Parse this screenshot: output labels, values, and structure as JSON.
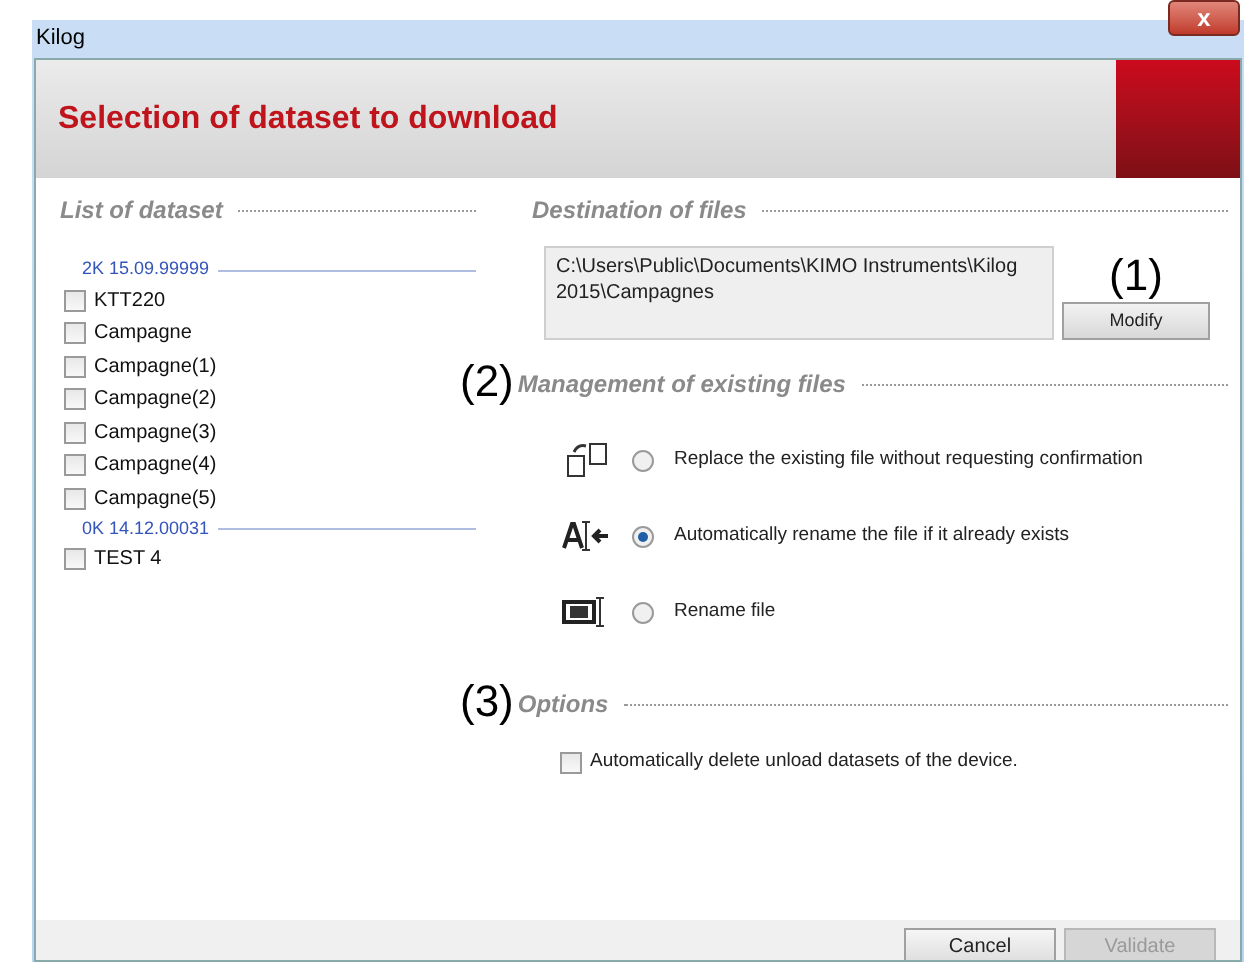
{
  "window": {
    "title": "Kilog",
    "close": "x"
  },
  "header": {
    "title": "Selection of dataset to download"
  },
  "datasets": {
    "title": "List of dataset",
    "groups": [
      {
        "name": "2K 15.09.99999",
        "items": [
          {
            "label": "KTT220",
            "checked": false
          },
          {
            "label": "Campagne",
            "checked": false
          },
          {
            "label": "Campagne(1)",
            "checked": false
          },
          {
            "label": "Campagne(2)",
            "checked": false
          },
          {
            "label": "Campagne(3)",
            "checked": false
          },
          {
            "label": "Campagne(4)",
            "checked": false
          },
          {
            "label": "Campagne(5)",
            "checked": false
          }
        ]
      },
      {
        "name": "0K 14.12.00031",
        "items": [
          {
            "label": "TEST 4",
            "checked": false
          }
        ]
      }
    ]
  },
  "destination": {
    "title": "Destination of files",
    "marker": "(1)",
    "path": "C:\\Users\\Public\\Documents\\KIMO Instruments\\Kilog 2015\\Campagnes",
    "button": "Modify"
  },
  "management": {
    "title": "Management of existing files",
    "marker": "(2)",
    "options": [
      {
        "kind": "replace",
        "label": "Replace the existing file without requesting confirmation",
        "selected": false
      },
      {
        "kind": "autorename",
        "label": "Automatically rename the file if it already exists",
        "selected": true
      },
      {
        "kind": "rename",
        "label": "Rename file",
        "selected": false
      }
    ]
  },
  "options": {
    "title": "Options",
    "marker": "(3)",
    "items": [
      {
        "label": "Automatically delete unload datasets of the device.",
        "checked": false
      }
    ]
  },
  "buttons": [
    {
      "label": "Cancel",
      "disabled": false
    },
    {
      "label": "Validate",
      "disabled": true
    }
  ]
}
